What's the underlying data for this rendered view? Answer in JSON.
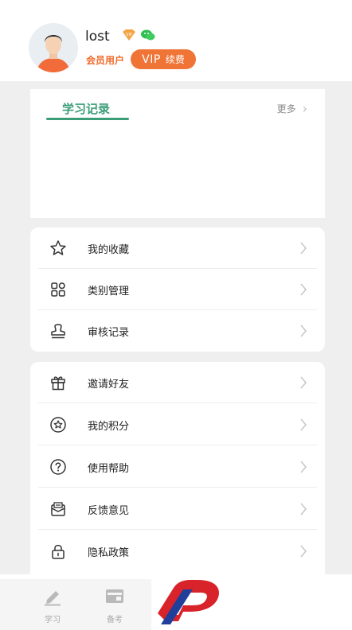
{
  "profile": {
    "username": "lost",
    "member_label": "会员用户",
    "vip_label": "VIP",
    "renew_label": "续费"
  },
  "study": {
    "title": "学习记录",
    "more_label": "更多"
  },
  "menu_group_1": [
    {
      "label": "我的收藏",
      "icon": "star-icon"
    },
    {
      "label": "类别管理",
      "icon": "grid-icon"
    },
    {
      "label": "审核记录",
      "icon": "stamp-icon"
    }
  ],
  "menu_group_2": [
    {
      "label": "邀请好友",
      "icon": "gift-icon"
    },
    {
      "label": "我的积分",
      "icon": "points-icon"
    },
    {
      "label": "使用帮助",
      "icon": "help-icon"
    },
    {
      "label": "反馈意见",
      "icon": "feedback-icon"
    },
    {
      "label": "隐私政策",
      "icon": "lock-icon"
    }
  ],
  "tabbar": {
    "tabs": [
      {
        "label": "学习",
        "icon": "pen-icon"
      },
      {
        "label": "备考",
        "icon": "card-icon"
      }
    ]
  },
  "colors": {
    "accent_green": "#3a9d78",
    "vip_orange": "#f07436"
  }
}
